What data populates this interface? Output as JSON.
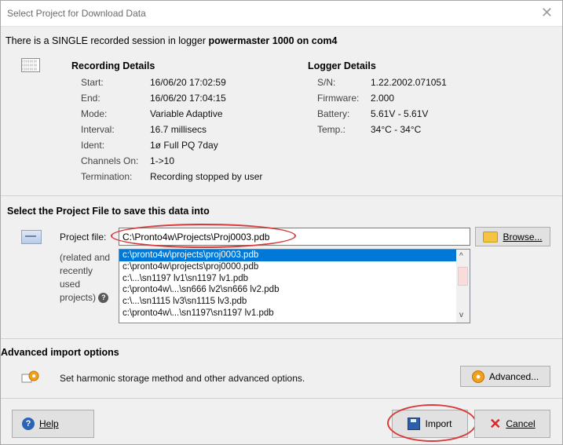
{
  "window": {
    "title": "Select Project for Download Data",
    "close_symbol": "✕"
  },
  "info": {
    "prefix": "There is a SINGLE recorded session in logger ",
    "logger": "powermaster 1000 on com4"
  },
  "recording": {
    "heading": "Recording Details",
    "rows": [
      {
        "label": "Start:",
        "value": "16/06/20 17:02:59"
      },
      {
        "label": "End:",
        "value": "16/06/20 17:04:15"
      },
      {
        "label": "Mode:",
        "value": "Variable Adaptive"
      },
      {
        "label": "Interval:",
        "value": "16.7 millisecs"
      },
      {
        "label": "Ident:",
        "value": "1ø Full PQ 7day"
      },
      {
        "label": "Channels On:",
        "value": "1->10"
      },
      {
        "label": "Termination:",
        "value": "Recording stopped by user"
      }
    ]
  },
  "logger_details": {
    "heading": "Logger Details",
    "rows": [
      {
        "label": "S/N:",
        "value": "1.22.2002.071051"
      },
      {
        "label": "Firmware:",
        "value": "2.000"
      },
      {
        "label": "Battery:",
        "value": "5.61V - 5.61V"
      },
      {
        "label": "Temp.:",
        "value": "34°C - 34°C"
      }
    ]
  },
  "project": {
    "heading": "Select the Project File to save this data into",
    "file_label": "Project file:",
    "file_value": "C:\\Pronto4w\\Projects\\Proj0003.pdb",
    "browse_label": "Browse...",
    "related_label_1": "(related and",
    "related_label_2": "recently",
    "related_label_3": "used",
    "related_label_4": "projects)",
    "help_mark": "?",
    "recent": [
      "c:\\pronto4w\\projects\\proj0003.pdb",
      "c:\\pronto4w\\projects\\proj0000.pdb",
      "c:\\...\\sn1197 lv1\\sn1197 lv1.pdb",
      "c:\\pronto4w\\...\\sn666 lv2\\sn666 lv2.pdb",
      "c:\\...\\sn1115 lv3\\sn1115 lv3.pdb",
      "c:\\pronto4w\\...\\sn1197\\sn1197 lv1.pdb"
    ],
    "scroll_up": "^",
    "scroll_down": "v"
  },
  "advanced": {
    "heading": "Advanced import options",
    "description": "Set harmonic storage method and other advanced options.",
    "button_label": "Advanced..."
  },
  "footer": {
    "help_label": "Help",
    "help_mark": "?",
    "import_label": "Import",
    "cancel_label": "Cancel",
    "cancel_symbol": "✕"
  }
}
